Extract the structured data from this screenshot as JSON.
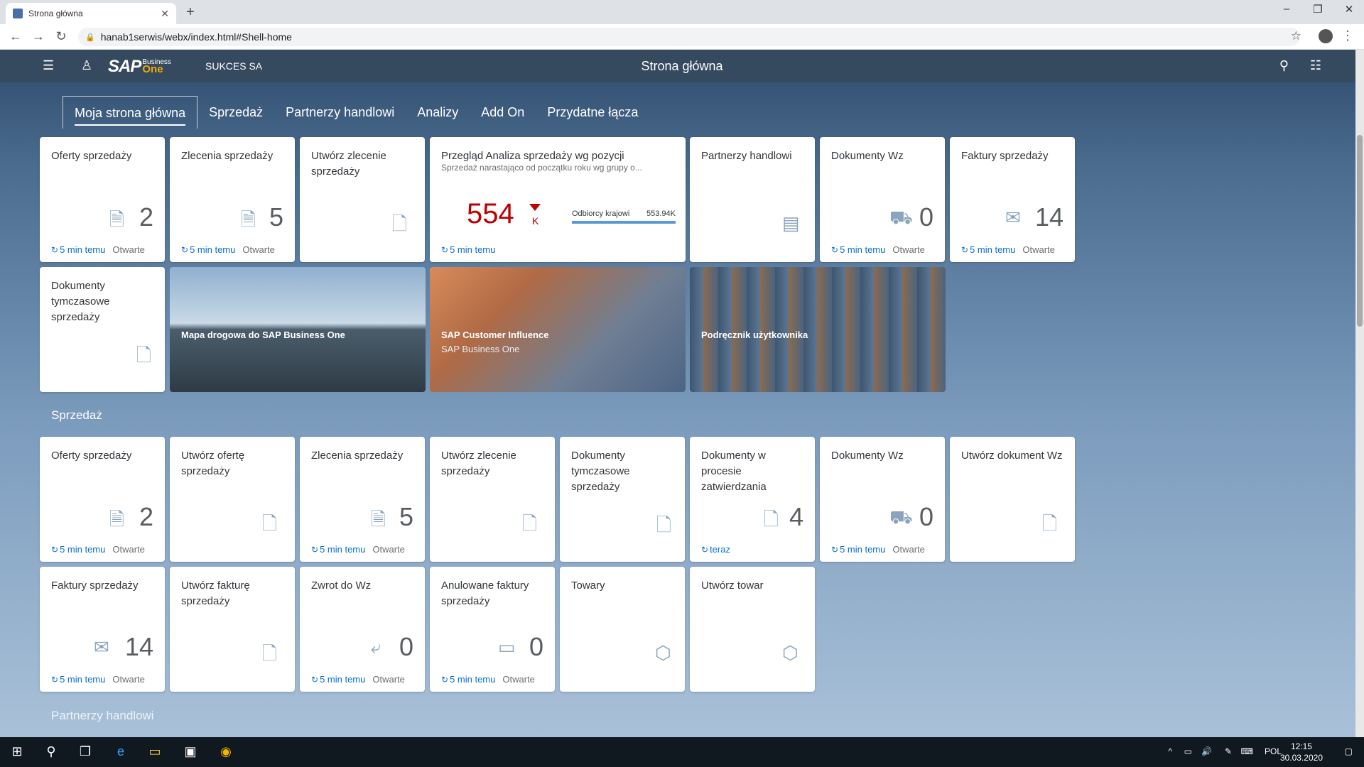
{
  "browser": {
    "tab_title": "Strona główna",
    "url": "hanab1serwis/webx/index.html#Shell-home"
  },
  "shell": {
    "company": "SUKCES SA",
    "title": "Strona główna",
    "logo_sap": "SAP",
    "logo_business": "Business",
    "logo_one": "One"
  },
  "nav_tabs": [
    "Moja strona główna",
    "Sprzedaż",
    "Partnerzy handlowi",
    "Analizy",
    "Add On",
    "Przydatne łącza"
  ],
  "refresh": "5 min temu",
  "refresh_now": "teraz",
  "status_open": "Otwarte",
  "home_tiles": [
    {
      "title": "Oferty sprzedaży",
      "count": "2"
    },
    {
      "title": "Zlecenia sprzedaży",
      "count": "5"
    },
    {
      "title": "Utwórz zlecenie sprzedaży"
    },
    {
      "title": "Partnerzy handlowi"
    },
    {
      "title": "Dokumenty Wz",
      "count": "0"
    },
    {
      "title": "Faktury sprzedaży",
      "count": "14"
    },
    {
      "title": "Dokumenty tymczasowe sprzedaży"
    }
  ],
  "analysis_tile": {
    "title": "Przegląd Analiza sprzedaży wg pozycji",
    "subtitle": "Sprzedaż narastająco od początku roku wg grupy o...",
    "kpi": "554",
    "unit": "K",
    "bar_label": "Odbiorcy krajowi",
    "bar_value": "553.94K"
  },
  "image_tiles": [
    {
      "caption": "Mapa drogowa do SAP Business One"
    },
    {
      "caption": "SAP Customer Influence",
      "sub": "SAP Business One"
    },
    {
      "caption": "Podręcznik użytkownika"
    }
  ],
  "sections": {
    "sales": "Sprzedaż",
    "partners": "Partnerzy handlowi"
  },
  "sales_tiles": [
    {
      "title": "Oferty sprzedaży",
      "count": "2"
    },
    {
      "title": "Utwórz ofertę sprzedaży"
    },
    {
      "title": "Zlecenia sprzedaży",
      "count": "5"
    },
    {
      "title": "Utwórz zlecenie sprzedaży"
    },
    {
      "title": "Dokumenty tymczasowe sprzedaży"
    },
    {
      "title": "Dokumenty w procesie zatwierdzania",
      "count": "4"
    },
    {
      "title": "Dokumenty Wz",
      "count": "0"
    },
    {
      "title": "Utwórz dokument Wz"
    },
    {
      "title": "Faktury sprzedaży",
      "count": "14"
    },
    {
      "title": "Utwórz fakturę sprzedaży"
    },
    {
      "title": "Zwrot do Wz",
      "count": "0"
    },
    {
      "title": "Anulowane faktury sprzedaży",
      "count": "0"
    },
    {
      "title": "Towary"
    },
    {
      "title": "Utwórz towar"
    }
  ],
  "taskbar": {
    "lang": "POL",
    "time": "12:15",
    "date": "30.03.2020"
  }
}
